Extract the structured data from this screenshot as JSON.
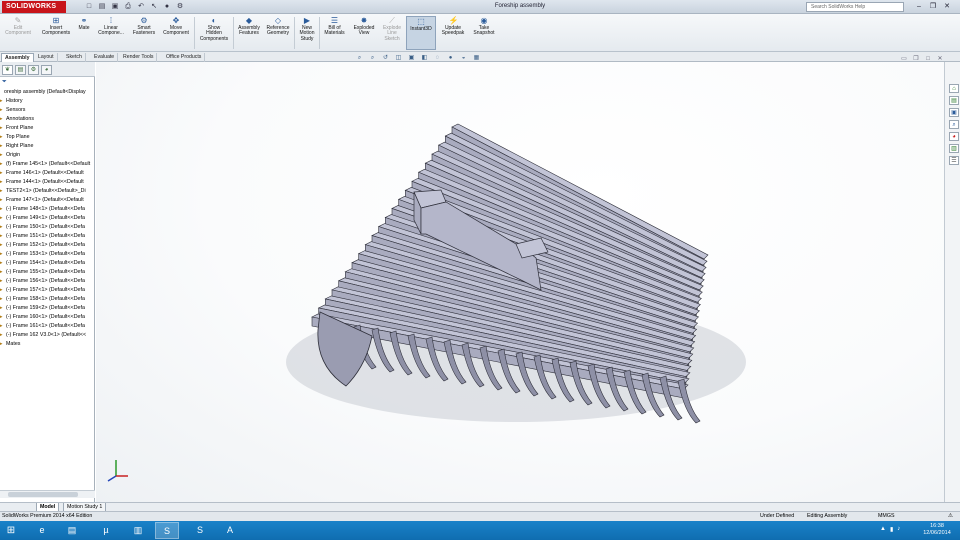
{
  "app": {
    "logo_text": "SOLIDWORKS",
    "doc_title": "Foreship assembly",
    "search_placeholder": "Search SolidWorks Help"
  },
  "quick_access": [
    "new-icon",
    "open-icon",
    "save-icon",
    "print-icon",
    "undo-icon",
    "select-icon",
    "rebuild-icon",
    "options-icon"
  ],
  "window_controls": [
    "minimize-icon",
    "restore-icon",
    "close-icon"
  ],
  "commands": [
    {
      "label": "Edit\nComponent",
      "icon": "edit-component-icon",
      "disabled": true
    },
    {
      "label": "Insert\nComponents",
      "icon": "insert-components-icon"
    },
    {
      "label": "Mate",
      "icon": "mate-icon"
    },
    {
      "label": "Linear\nCompone...",
      "icon": "linear-pattern-icon"
    },
    {
      "label": "Smart\nFasteners",
      "icon": "smart-fasteners-icon"
    },
    {
      "label": "Move\nComponent",
      "icon": "move-component-icon"
    },
    {
      "label": "Show\nHidden\nComponents",
      "icon": "show-hidden-icon"
    },
    {
      "label": "Assembly\nFeatures",
      "icon": "assembly-features-icon"
    },
    {
      "label": "Reference\nGeometry",
      "icon": "reference-geometry-icon"
    },
    {
      "label": "New\nMotion\nStudy",
      "icon": "motion-study-icon"
    },
    {
      "label": "Bill of\nMaterials",
      "icon": "bom-icon"
    },
    {
      "label": "Exploded\nView",
      "icon": "exploded-view-icon"
    },
    {
      "label": "Explode\nLine\nSketch",
      "icon": "explode-line-icon",
      "disabled": true
    },
    {
      "label": "Instant3D",
      "icon": "instant3d-icon",
      "active": true
    },
    {
      "label": "Update\nSpeedpak",
      "icon": "speedpak-icon"
    },
    {
      "label": "Take\nSnapshot",
      "icon": "snapshot-icon"
    }
  ],
  "cm_tabs": [
    "Assembly",
    "Layout",
    "Sketch",
    "Evaluate",
    "Render Tools",
    "Office Products"
  ],
  "fm_tabs": [
    "feature-manager-icon",
    "property-manager-icon",
    "configuration-manager-icon",
    "display-manager-icon"
  ],
  "tree": [
    {
      "label": "oreship assembly  (Default<Display",
      "root": true
    },
    {
      "label": "History"
    },
    {
      "label": "Sensors"
    },
    {
      "label": "Annotations"
    },
    {
      "label": "Front Plane"
    },
    {
      "label": "Top Plane"
    },
    {
      "label": "Right Plane"
    },
    {
      "label": "Origin"
    },
    {
      "label": "(f) Frame 145<1> (Default<<Default"
    },
    {
      "label": "Frame 146<1> (Default<<Default"
    },
    {
      "label": "Frame 144<1> (Default<<Default"
    },
    {
      "label": "TEST2<1> (Default<<Default>_Di"
    },
    {
      "label": "Frame 147<1> (Default<<Default"
    },
    {
      "label": "(-) Frame 148<1> (Default<<Defa"
    },
    {
      "label": "(-) Frame 149<1> (Default<<Defa"
    },
    {
      "label": "(-) Frame 150<1> (Default<<Defa"
    },
    {
      "label": "(-) Frame 151<1> (Default<<Defa"
    },
    {
      "label": "(-) Frame 152<1> (Default<<Defa"
    },
    {
      "label": "(-) Frame 153<1> (Default<<Defa"
    },
    {
      "label": "(-) Frame 154<1> (Default<<Defa"
    },
    {
      "label": "(-) Frame 155<1> (Default<<Defa"
    },
    {
      "label": "(-) Frame 156<1> (Default<<Defa"
    },
    {
      "label": "(-) Frame 157<1> (Default<<Defa"
    },
    {
      "label": "(-) Frame 158<1> (Default<<Defa"
    },
    {
      "label": "(-) Frame 159<2> (Default<<Defa"
    },
    {
      "label": "(-) Frame 160<1> (Default<<Defa"
    },
    {
      "label": "(-) Frame 161<1> (Default<<Defa"
    },
    {
      "label": "(-) Frame 162 V3.0<1> (Default<<"
    },
    {
      "label": "Mates"
    }
  ],
  "model_tabs": [
    "Model",
    "Motion Study 1"
  ],
  "status": {
    "edition": "SolidWorks Premium 2014 x64 Edition",
    "definition": "Under Defined",
    "mode": "Editing Assembly",
    "units": "MMGS"
  },
  "colors": {
    "model_face": "#a9abbf",
    "model_edge": "#2e2f3a",
    "accent": "#c8141a"
  },
  "taskbar": {
    "apps": [
      "ie-icon",
      "chrome-icon",
      "explorer-icon",
      "torrent-icon",
      "notes-icon",
      "solidworks-icon",
      "skype-icon",
      "acrobat-icon"
    ],
    "time": "16:38",
    "date": "12/06/2014"
  }
}
